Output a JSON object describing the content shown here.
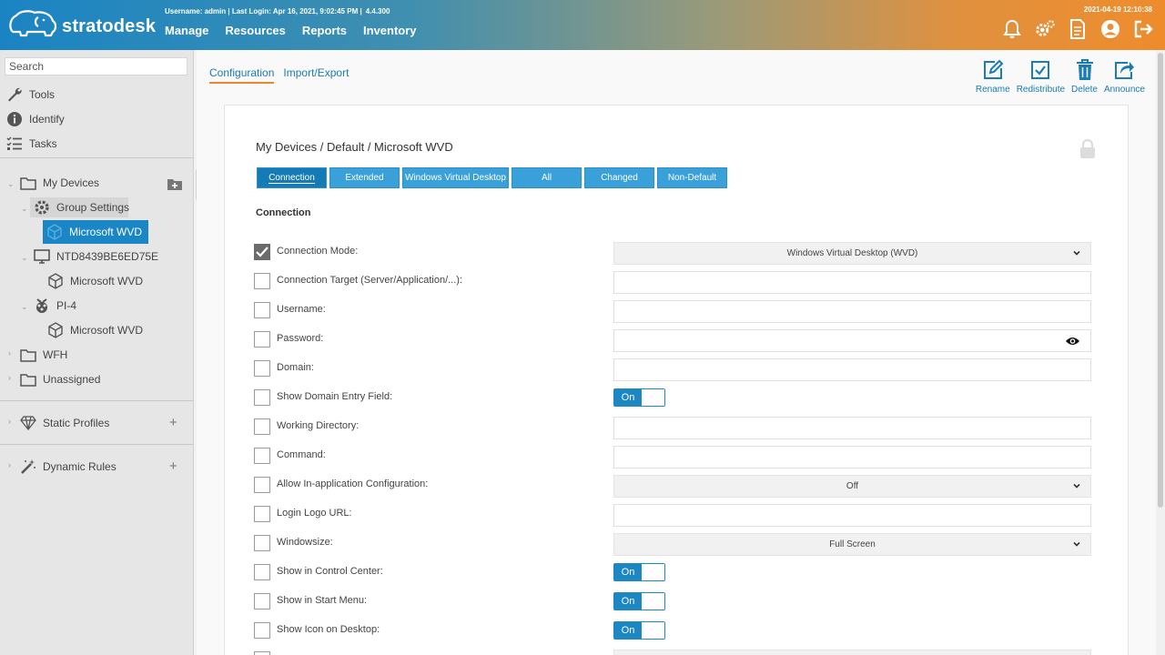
{
  "app": {
    "logo": "stratodesk"
  },
  "header": {
    "userinfo": "Username: admin | Last Login: Apr 16, 2021, 9:02:45 PM |",
    "version": "4.4.300",
    "datetime": "2021-04-19 12:10:38",
    "nav": [
      "Manage",
      "Resources",
      "Reports",
      "Inventory"
    ]
  },
  "sidebar": {
    "search_placeholder": "Search",
    "tools": [
      "Tools",
      "Identify",
      "Tasks"
    ],
    "tree": {
      "my_devices": "My Devices",
      "group_settings": "Group Settings",
      "group_profile": "Microsoft WVD",
      "device1": "NTD8439BE6ED75E",
      "device1_profile": "Microsoft WVD",
      "device2": "PI-4",
      "device2_profile": "Microsoft WVD",
      "wfh": "WFH",
      "unassigned": "Unassigned"
    },
    "static_profiles": "Static Profiles",
    "dynamic_rules": "Dynamic Rules"
  },
  "main": {
    "tabs": [
      "Configuration",
      "Import/Export"
    ],
    "actions": [
      "Rename",
      "Redistribute",
      "Delete",
      "Announce"
    ],
    "breadcrumb": "My Devices / Default / Microsoft WVD",
    "filters": [
      "Connection",
      "Extended",
      "Windows Virtual Desktop",
      "All",
      "Changed",
      "Non-Default"
    ],
    "section": "Connection",
    "settings": [
      {
        "label": "Connection Mode:",
        "checked": true,
        "type": "select",
        "value": "Windows Virtual Desktop (WVD)"
      },
      {
        "label": "Connection Target (Server/Application/...):",
        "checked": false,
        "type": "input",
        "value": ""
      },
      {
        "label": "Username:",
        "checked": false,
        "type": "input",
        "value": ""
      },
      {
        "label": "Password:",
        "checked": false,
        "type": "password",
        "value": ""
      },
      {
        "label": "Domain:",
        "checked": false,
        "type": "input",
        "value": ""
      },
      {
        "label": "Show Domain Entry Field:",
        "checked": false,
        "type": "toggle",
        "value": "On"
      },
      {
        "label": "Working Directory:",
        "checked": false,
        "type": "input",
        "value": ""
      },
      {
        "label": "Command:",
        "checked": false,
        "type": "input",
        "value": ""
      },
      {
        "label": "Allow In-application Configuration:",
        "checked": false,
        "type": "select",
        "value": "Off"
      },
      {
        "label": "Login Logo URL:",
        "checked": false,
        "type": "input",
        "value": ""
      },
      {
        "label": "Windowsize:",
        "checked": false,
        "type": "select",
        "value": "Full Screen"
      },
      {
        "label": "Show in Control Center:",
        "checked": false,
        "type": "toggle",
        "value": "On"
      },
      {
        "label": "Show in Start Menu:",
        "checked": false,
        "type": "toggle",
        "value": "On"
      },
      {
        "label": "Show Icon on Desktop:",
        "checked": false,
        "type": "toggle",
        "value": "On"
      }
    ]
  },
  "colors": {
    "accent": "#1a86c6",
    "tab_underline": "#e8882c",
    "filter": "#3aa0d9"
  }
}
